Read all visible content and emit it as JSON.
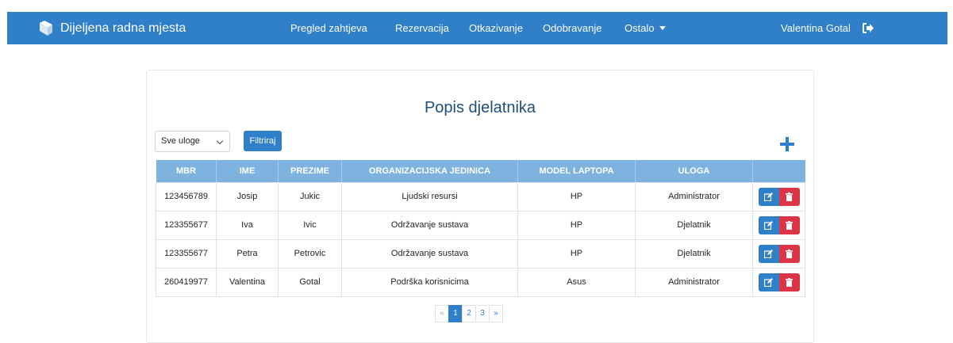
{
  "brand": {
    "title": "Dijeljena radna mjesta"
  },
  "nav": {
    "items": [
      {
        "label": "Pregled zahtjeva"
      },
      {
        "label": "Rezervacija"
      },
      {
        "label": "Otkazivanje"
      },
      {
        "label": "Odobravanje"
      },
      {
        "label": "Ostalo"
      }
    ],
    "user": "Valentina Gotal"
  },
  "main": {
    "title": "Popis djelatnika",
    "filter": {
      "selected": "Sve uloge",
      "button": "Filtriraj"
    },
    "table": {
      "headers": [
        "MBR",
        "IME",
        "PREZIME",
        "ORGANIZACIJSKA JEDINICA",
        "MODEL LAPTOPA",
        "ULOGA"
      ],
      "rows": [
        [
          "123456789",
          "Josip",
          "Jukic",
          "Ljudski resursi",
          "HP",
          "Administrator"
        ],
        [
          "123355677",
          "Iva",
          "Ivic",
          "Održavanje sustava",
          "HP",
          "Djelatnik"
        ],
        [
          "123355677",
          "Petra",
          "Petrovic",
          "Održavanje sustava",
          "HP",
          "Djelatnik"
        ],
        [
          "260419977",
          "Valentina",
          "Gotal",
          "Podrška korisnicima",
          "Asus",
          "Administrator"
        ]
      ]
    },
    "pagination": {
      "prev": "«",
      "pages": [
        "1",
        "2",
        "3"
      ],
      "next": "»",
      "current": "1"
    }
  },
  "colors": {
    "primary": "#2f7fc9",
    "header": "#7fb3df",
    "danger": "#dc3545",
    "title": "#1f4e79"
  }
}
